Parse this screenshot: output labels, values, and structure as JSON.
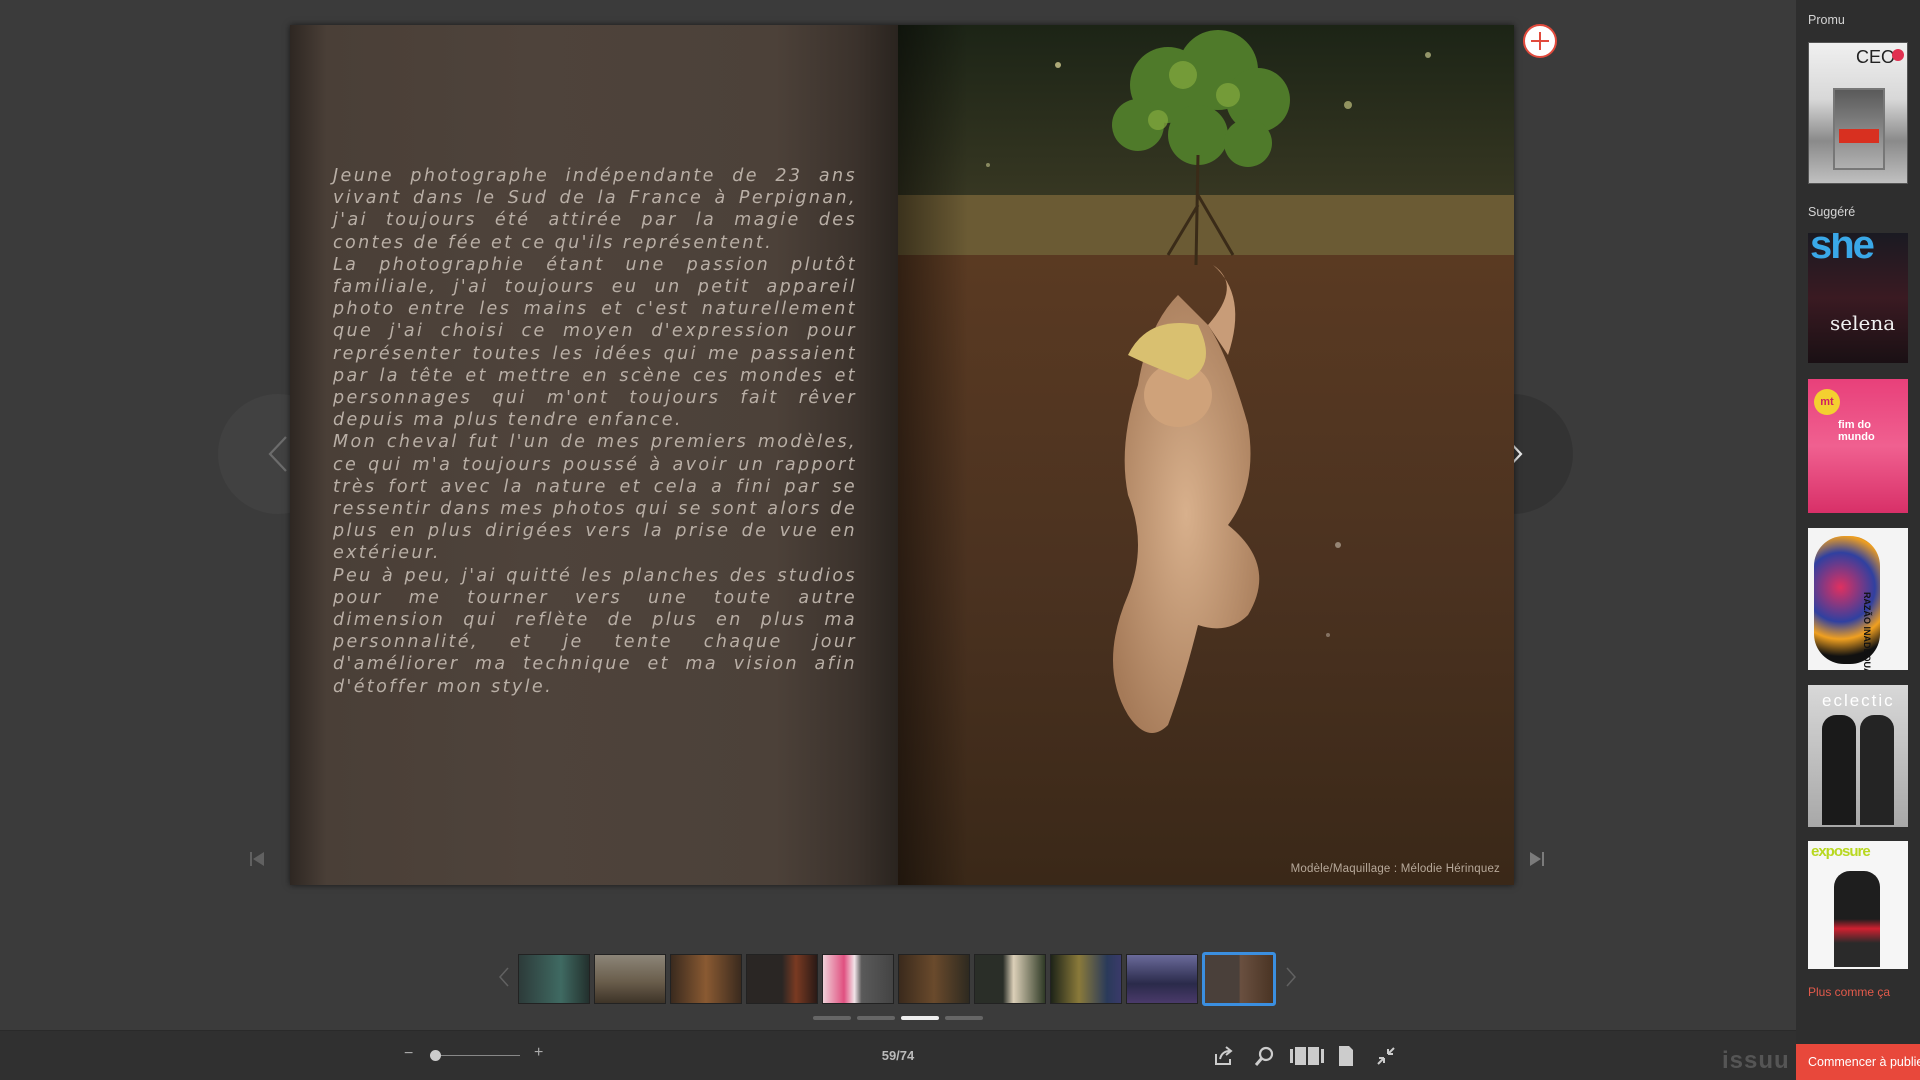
{
  "reader": {
    "left_page_paragraphs": [
      "Jeune photographe indépendante de 23 ans vivant dans le Sud de la France à Perpignan, j'ai toujours été attirée par la magie des contes de fée et ce qu'ils représentent.",
      "La photographie étant une passion plutôt familiale, j'ai toujours eu un petit appareil photo entre les mains et c'est naturellement que j'ai choisi ce moyen d'expression pour représenter toutes les idées qui me passaient par la tête et mettre en scène ces mondes et personnages qui m'ont toujours fait rêver depuis ma plus tendre enfance.",
      "Mon cheval fut l'un de mes premiers modèles, ce qui m'a toujours poussé à avoir un rapport très fort avec la nature et cela a fini par se ressentir dans mes photos qui se sont alors de plus en plus dirigées vers la prise de vue en extérieur.",
      "Peu à peu, j'ai quitté les planches des studios pour me tourner vers une toute autre dimension qui reflète de plus en plus ma personnalité, et je tente chaque jour d'améliorer ma technique et ma vision afin d'étoffer mon style."
    ],
    "photo_credit": "Modèle/Maquillage : Mélodie Hérinquez"
  },
  "toolbar": {
    "zoom_out": "−",
    "zoom_in": "+",
    "zoom_level": 0,
    "page_indicator": "59/74"
  },
  "thumbnail_strip": {
    "active_index": 9,
    "pager_active_index": 2,
    "pager_count": 4
  },
  "sidebar": {
    "promo_heading": "Promu",
    "suggested_heading": "Suggéré",
    "more_link": "Plus comme ça",
    "brand": "issuu",
    "start_button": "Commencer à publier",
    "promo_cover_text": "CEO",
    "suggested_cover_texts": [
      "she",
      "selena",
      "mt",
      "fim do mundo",
      "RAZÃO INADEQUADA",
      "eclectic",
      "exposure"
    ]
  },
  "colors": {
    "accent": "#e8483b",
    "active_thumb_border": "#3b8fe0",
    "background": "#3a3a3a"
  }
}
